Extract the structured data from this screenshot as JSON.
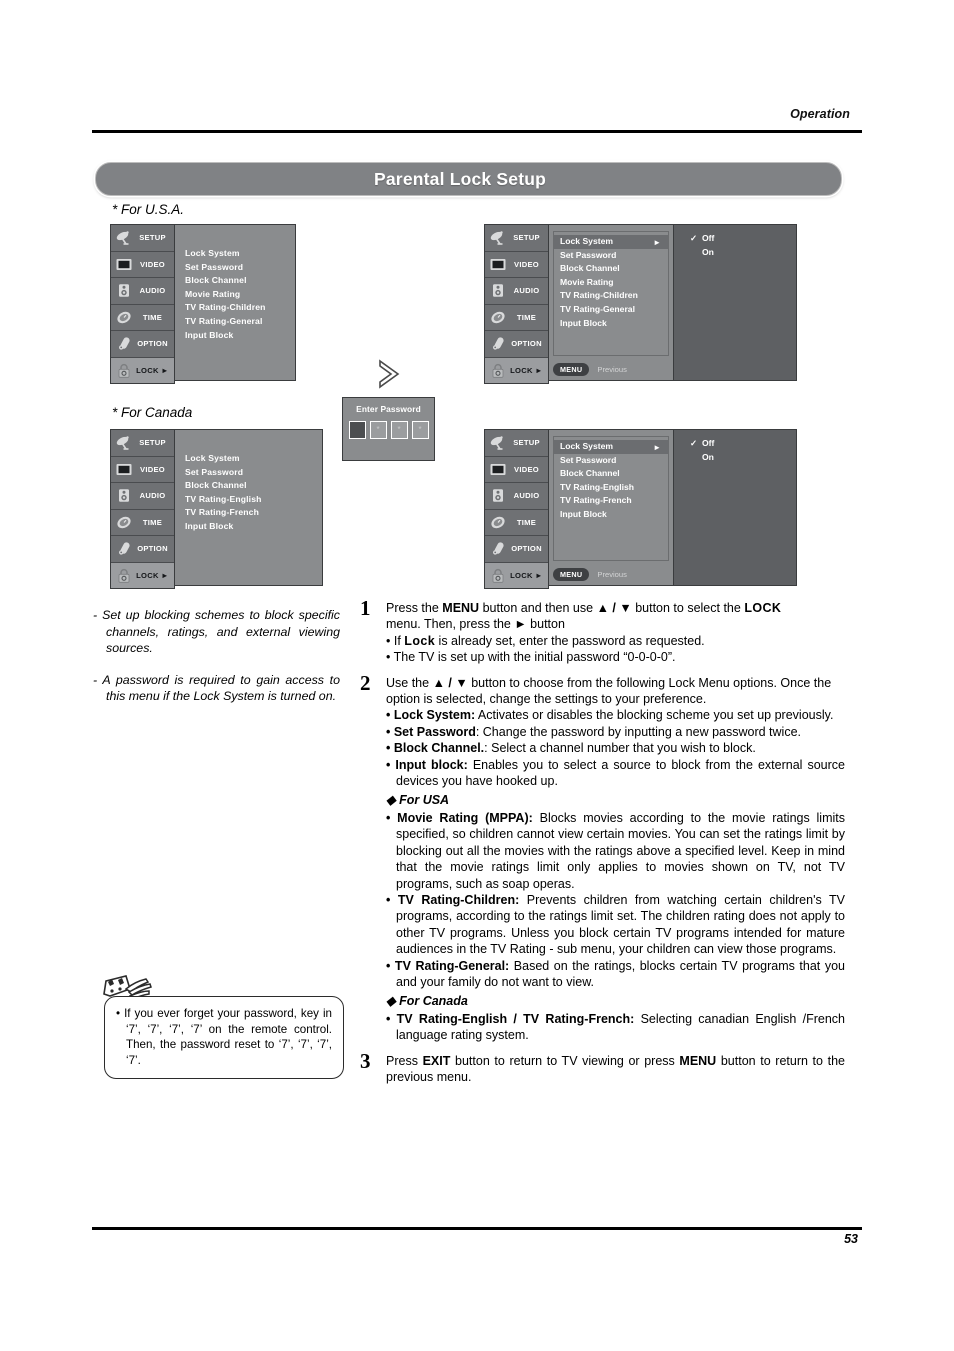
{
  "header": {
    "section_label": "Operation",
    "title": "Parental Lock Setup"
  },
  "captions": {
    "usa": "* For U.S.A.",
    "canada": "* For Canada"
  },
  "osd": {
    "sidebar": [
      {
        "label": "SETUP",
        "icon": "satellite-dish-icon"
      },
      {
        "label": "VIDEO",
        "icon": "monitor-icon"
      },
      {
        "label": "AUDIO",
        "icon": "speaker-icon"
      },
      {
        "label": "TIME",
        "icon": "clock-icon"
      },
      {
        "label": "OPTION",
        "icon": "remote-control-icon"
      },
      {
        "label": "LOCK ►",
        "icon": "padlock-icon"
      }
    ],
    "usa_items": [
      "Lock System",
      "Set Password",
      "Block Channel",
      "Movie Rating",
      "TV Rating-Children",
      "TV Rating-General",
      "Input Block"
    ],
    "canada_items": [
      "Lock System",
      "Set Password",
      "Block Channel",
      "TV Rating-English",
      "TV Rating-French",
      "Input Block"
    ],
    "highlight_arrow": "►",
    "footer_button": "MENU",
    "footer_text": "Previous",
    "options": [
      "Off",
      "On"
    ],
    "checked_option": "Off",
    "check_glyph": "✓"
  },
  "password_dialog": {
    "title": "Enter Password",
    "cells": [
      "",
      "*",
      "*",
      "*"
    ]
  },
  "flow_arrow": "chevron-right-outline",
  "left_notes": [
    "- Set up blocking schemes to block specific channels, ratings, and external viewing sources.",
    "- A password is required to gain access to this menu if the Lock System is turned on."
  ],
  "tip_note": "• If you ever forget your password, key in ‘7’, ‘7’, ‘7’, ‘7’ on the remote control. Then, the password reset to ‘7’, ‘7’, ‘7’, ‘7’.",
  "steps": [
    {
      "number": "1",
      "line1_a": "Press the ",
      "line1_menu": "MENU",
      "line1_b": " button and then use ",
      "line1_updown": "▲ / ▼",
      "line1_c": " button to select the ",
      "line1_lock": "LOCK",
      "line2_a": "menu. Then, press the ",
      "line2_arrow": "►",
      "line2_b": " button",
      "bullets": [
        {
          "a": "• If ",
          "bold": "Lock",
          "b": " is already set, enter the password as requested."
        },
        {
          "a": "• The TV is set up with the initial password “0-0-0-0”.",
          "bold": "",
          "b": ""
        }
      ]
    },
    {
      "number": "2",
      "lead_a": "Use the ",
      "lead_updown": "▲ / ▼",
      "lead_b": " button to choose from the following Lock Menu options. Once the option is selected, change the settings to your preference.",
      "options": [
        {
          "term": "• Lock System:",
          "desc": " Activates or disables the blocking scheme you set up previously."
        },
        {
          "term": "• Set Password",
          "desc": ": Change the password by inputting a new password twice."
        },
        {
          "term": "• Block Channel.",
          "desc": ": Select a channel number that you wish to block."
        },
        {
          "term": "• Input block:",
          "desc": " Enables you to select a source to block from the external source devices you have hooked up."
        }
      ],
      "usa_heading": "◆ For USA",
      "usa_options": [
        {
          "term": "• Movie Rating (MPPA):",
          "desc": " Blocks movies according to the movie ratings limits specified, so children cannot view certain movies. You can set the ratings limit by blocking out all the movies with the ratings above a specified level. Keep in mind that the movie ratings limit only applies to movies shown on TV, not TV programs, such as soap operas."
        },
        {
          "term": "• TV Rating-Children:",
          "desc": " Prevents children from watching certain children's TV programs, according to the ratings limit set. The children rating does not apply to other TV programs. Unless you block certain TV programs intended for mature audiences in the TV Rating - sub menu, your children can view those programs."
        },
        {
          "term": "• TV Rating-General:",
          "desc": " Based on the ratings, blocks certain TV programs that you and your family do not want to view."
        }
      ],
      "canada_heading": "◆ For Canada",
      "canada_options": [
        {
          "term": "• TV Rating-English / TV Rating-French:",
          "desc": " Selecting canadian English /French language rating system."
        }
      ]
    },
    {
      "number": "3",
      "a": "Press ",
      "exit": "EXIT",
      "b": " button to return to TV viewing or press ",
      "menu": "MENU",
      "c": " button to return to the previous menu."
    }
  ],
  "footer": {
    "page_number": "53"
  }
}
